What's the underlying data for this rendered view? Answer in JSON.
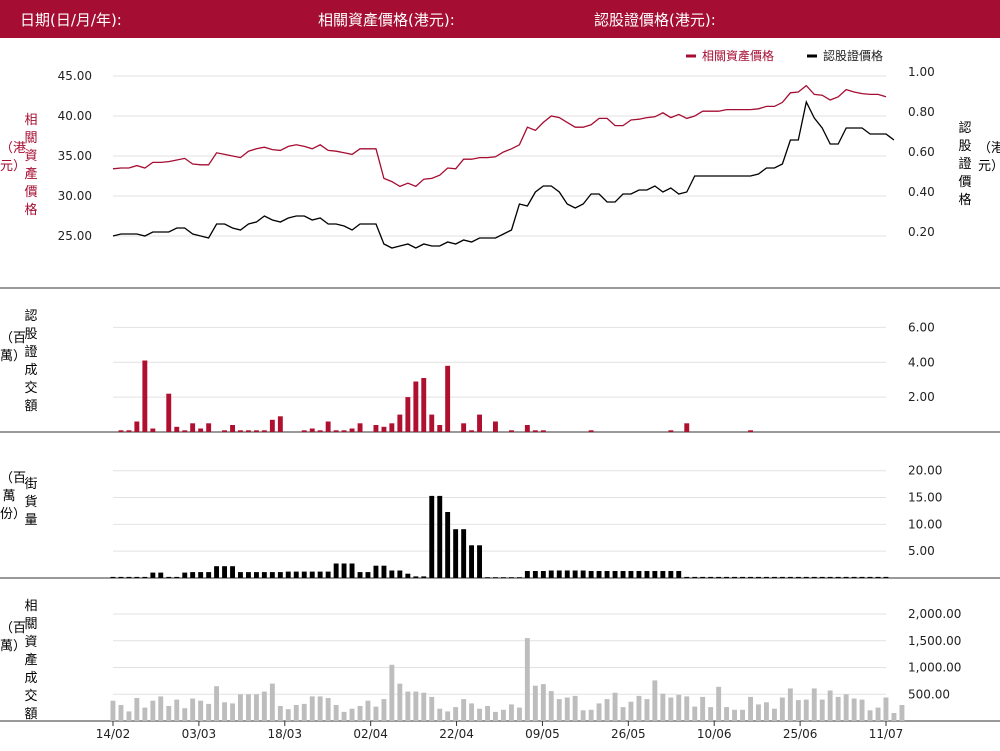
{
  "header": {
    "date_label": "日期(日/月/年):",
    "underlying_label": "相關資產價格(港元):",
    "warrant_label": "認股證價格(港元):"
  },
  "colors": {
    "header_bg": "#a50d32",
    "underlying": "#a50d32",
    "warrant": "#000000",
    "volume": "#b0102f",
    "outstanding": "#000000",
    "turnover": "#bdbdbd"
  },
  "chart_data": [
    {
      "type": "line",
      "panel": "price",
      "x_ticks": [
        "14/02",
        "03/03",
        "18/03",
        "02/04",
        "22/04",
        "09/05",
        "26/05",
        "10/06",
        "25/06",
        "11/07"
      ],
      "legend": {
        "placement": "top-right",
        "entries": [
          "相關資產價格",
          "認股證價格"
        ]
      },
      "left_axis": {
        "label": "（港元）相關資產價格",
        "ticks": [
          "25.00",
          "30.00",
          "35.00",
          "40.00",
          "45.00"
        ],
        "ylim": [
          21,
          47
        ]
      },
      "right_axis": {
        "label": "認股證價格（港元）",
        "ticks": [
          "0.20",
          "0.40",
          "0.60",
          "0.80",
          "1.00"
        ],
        "ylim": [
          0.02,
          1.06
        ]
      },
      "series": [
        {
          "name": "相關資產價格",
          "axis": "left",
          "values": [
            33.4,
            33.5,
            33.5,
            33.8,
            33.5,
            34.2,
            34.2,
            34.3,
            34.5,
            34.7,
            34.0,
            33.9,
            33.9,
            35.4,
            35.2,
            35.0,
            34.8,
            35.6,
            35.9,
            36.1,
            35.8,
            35.7,
            36.2,
            36.4,
            36.2,
            35.9,
            36.4,
            35.7,
            35.6,
            35.4,
            35.2,
            35.9,
            35.9,
            35.9,
            32.2,
            31.8,
            31.2,
            31.6,
            31.2,
            32.1,
            32.2,
            32.6,
            33.5,
            33.4,
            34.6,
            34.6,
            34.8,
            34.8,
            34.9,
            35.5,
            35.9,
            36.4,
            38.6,
            38.2,
            39.2,
            40.0,
            39.8,
            39.2,
            38.6,
            38.6,
            38.9,
            39.7,
            39.7,
            38.8,
            38.8,
            39.5,
            39.6,
            39.8,
            39.9,
            40.4,
            39.8,
            40.2,
            39.7,
            40.0,
            40.6,
            40.6,
            40.6,
            40.8,
            40.8,
            40.8,
            40.8,
            40.9,
            41.2,
            41.2,
            41.7,
            42.9,
            43.0,
            43.8,
            42.7,
            42.6,
            42.0,
            42.4,
            43.3,
            43.0,
            42.8,
            42.7,
            42.7,
            42.4
          ]
        },
        {
          "name": "認股證價格",
          "axis": "right",
          "values": [
            0.18,
            0.19,
            0.19,
            0.19,
            0.18,
            0.2,
            0.2,
            0.2,
            0.22,
            0.22,
            0.19,
            0.18,
            0.17,
            0.24,
            0.24,
            0.22,
            0.21,
            0.24,
            0.25,
            0.28,
            0.26,
            0.25,
            0.27,
            0.28,
            0.28,
            0.26,
            0.27,
            0.24,
            0.24,
            0.23,
            0.21,
            0.24,
            0.24,
            0.24,
            0.14,
            0.12,
            0.13,
            0.14,
            0.12,
            0.14,
            0.13,
            0.13,
            0.15,
            0.14,
            0.16,
            0.15,
            0.17,
            0.17,
            0.17,
            0.19,
            0.21,
            0.34,
            0.33,
            0.4,
            0.43,
            0.43,
            0.4,
            0.34,
            0.32,
            0.34,
            0.39,
            0.39,
            0.35,
            0.35,
            0.39,
            0.39,
            0.41,
            0.41,
            0.43,
            0.4,
            0.42,
            0.39,
            0.4,
            0.48,
            0.48,
            0.48,
            0.48,
            0.48,
            0.48,
            0.48,
            0.48,
            0.49,
            0.52,
            0.52,
            0.54,
            0.66,
            0.66,
            0.85,
            0.77,
            0.72,
            0.64,
            0.64,
            0.72,
            0.72,
            0.72,
            0.69,
            0.69,
            0.69,
            0.66
          ]
        }
      ]
    },
    {
      "type": "bar",
      "panel": "warrant_volume",
      "axis_label": "認股證成交額（百萬）",
      "ticks": [
        "2.00",
        "4.00",
        "6.00"
      ],
      "ylim": [
        0,
        7
      ],
      "series": [
        {
          "name": "認股證成交額",
          "values": [
            0,
            0.1,
            0.1,
            0.6,
            4.1,
            0.2,
            0,
            2.2,
            0.3,
            0.1,
            0.5,
            0.2,
            0.5,
            0,
            0.1,
            0.4,
            0.1,
            0.1,
            0.1,
            0.1,
            0.7,
            0.9,
            0,
            0,
            0.1,
            0.2,
            0.1,
            0.6,
            0.1,
            0.1,
            0.2,
            0.5,
            0,
            0.4,
            0.3,
            0.5,
            1.0,
            2.0,
            2.9,
            3.1,
            1.0,
            0.4,
            3.8,
            0,
            0.5,
            0.1,
            1.0,
            0,
            0.6,
            0,
            0.1,
            0,
            0.4,
            0.1,
            0.1,
            0,
            0,
            0,
            0,
            0,
            0.1,
            0,
            0,
            0,
            0,
            0,
            0,
            0,
            0,
            0,
            0.1,
            0,
            0.5,
            0,
            0,
            0,
            0,
            0,
            0,
            0,
            0.1,
            0,
            0,
            0,
            0,
            0,
            0,
            0,
            0,
            0,
            0,
            0,
            0,
            0,
            0,
            0,
            0,
            0
          ]
        }
      ]
    },
    {
      "type": "bar",
      "panel": "outstanding",
      "axis_label": "街貨量（百萬份）",
      "ticks": [
        "5.00",
        "10.00",
        "15.00",
        "20.00"
      ],
      "ylim": [
        0,
        22
      ],
      "series": [
        {
          "name": "街貨量",
          "values": [
            0.2,
            0.2,
            0.2,
            0.2,
            0.2,
            1.0,
            1.0,
            0.2,
            0.2,
            1.0,
            1.1,
            1.1,
            1.1,
            2.2,
            2.2,
            2.2,
            1.1,
            1.1,
            1.1,
            1.1,
            1.1,
            1.1,
            1.2,
            1.2,
            1.2,
            1.2,
            1.2,
            1.2,
            2.7,
            2.7,
            2.7,
            1.1,
            1.1,
            2.3,
            2.3,
            1.4,
            1.4,
            0.8,
            0.3,
            0.3,
            15.3,
            15.3,
            12.3,
            9.1,
            9.1,
            6.1,
            6.1,
            0.1,
            0.1,
            0.1,
            0.1,
            0.1,
            1.3,
            1.3,
            1.3,
            1.4,
            1.4,
            1.4,
            1.4,
            1.4,
            1.3,
            1.3,
            1.3,
            1.3,
            1.3,
            1.3,
            1.3,
            1.3,
            1.3,
            1.3,
            1.3,
            1.3,
            0.2,
            0.2,
            0.2,
            0.2,
            0.2,
            0.2,
            0.2,
            0.2,
            0.2,
            0.2,
            0.2,
            0.2,
            0.2,
            0.2,
            0.2,
            0.2,
            0.2,
            0.2,
            0.2,
            0.2,
            0.2,
            0.2,
            0.2,
            0.2,
            0.2,
            0.2
          ]
        }
      ]
    },
    {
      "type": "bar",
      "panel": "underlying_turnover",
      "axis_label": "相關資產成交額（百萬）",
      "ticks": [
        "500.00",
        "1,000.00",
        "1,500.00",
        "2,000.00"
      ],
      "ylim": [
        0,
        2300
      ],
      "series": [
        {
          "name": "相關資產成交額",
          "values": [
            380,
            300,
            180,
            430,
            250,
            380,
            460,
            280,
            400,
            240,
            420,
            380,
            320,
            650,
            350,
            330,
            500,
            500,
            500,
            550,
            700,
            280,
            220,
            300,
            320,
            460,
            460,
            430,
            300,
            170,
            230,
            280,
            380,
            270,
            410,
            1050,
            700,
            550,
            550,
            530,
            450,
            230,
            180,
            260,
            410,
            330,
            230,
            280,
            170,
            210,
            310,
            250,
            1550,
            660,
            690,
            560,
            410,
            440,
            470,
            200,
            210,
            330,
            410,
            530,
            260,
            360,
            470,
            410,
            760,
            510,
            440,
            490,
            460,
            270,
            450,
            260,
            640,
            260,
            210,
            210,
            450,
            310,
            350,
            230,
            440,
            610,
            390,
            400,
            610,
            400,
            570,
            450,
            500,
            420,
            400,
            200,
            250,
            440,
            150,
            300
          ]
        }
      ]
    }
  ]
}
